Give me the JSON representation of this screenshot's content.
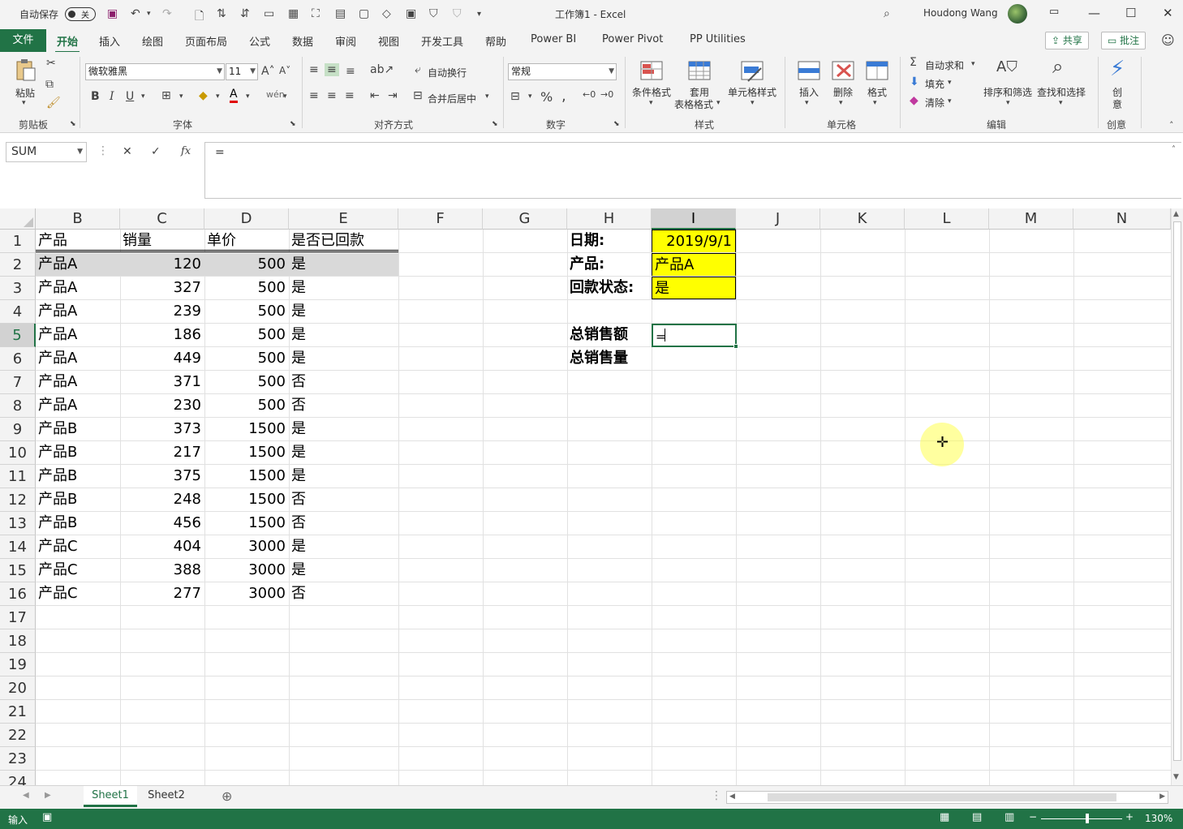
{
  "titlebar": {
    "autosave_label": "自动保存",
    "autosave_state": "关",
    "title": "工作簿1  -  Excel",
    "user": "Houdong Wang"
  },
  "tabs": {
    "file": "文件",
    "items": [
      "开始",
      "插入",
      "绘图",
      "页面布局",
      "公式",
      "数据",
      "审阅",
      "视图",
      "开发工具",
      "帮助",
      "Power BI",
      "Power Pivot",
      "PP Utilities"
    ],
    "share": "共享",
    "comments": "批注"
  },
  "ribbon": {
    "paste": "粘贴",
    "clipboard": "剪贴板",
    "font_name": "微软雅黑",
    "font_size": "11",
    "font_group": "字体",
    "wrap_text": "自动换行",
    "merge_center": "合并后居中",
    "align_group": "对齐方式",
    "number_format": "常规",
    "number_group": "数字",
    "cond_format": "条件格式",
    "table_format_1": "套用",
    "table_format_2": "表格格式",
    "cell_styles": "单元格样式",
    "styles_group": "样式",
    "insert": "插入",
    "delete": "删除",
    "format": "格式",
    "cells_group": "单元格",
    "autosum": "自动求和",
    "fill": "填充",
    "clear": "清除",
    "sort_filter": "排序和筛选",
    "find_select": "查找和选择",
    "edit_group": "编辑",
    "ideas_1": "创",
    "ideas_2": "意",
    "ideas_group": "创意"
  },
  "formula_bar": {
    "name_box": "SUM",
    "fx": "fx",
    "content": "="
  },
  "grid": {
    "columns": [
      "B",
      "C",
      "D",
      "E",
      "F",
      "G",
      "H",
      "I",
      "J",
      "K",
      "L",
      "M",
      "N"
    ],
    "selected_column": "I",
    "rows": [
      "1",
      "2",
      "3",
      "4",
      "5",
      "6",
      "7",
      "8",
      "9",
      "10",
      "11",
      "12",
      "13",
      "14",
      "15",
      "16",
      "17",
      "18",
      "19",
      "20",
      "21",
      "22",
      "23",
      "24"
    ],
    "selected_row": "5",
    "headers": [
      "产品",
      "销量",
      "单价",
      "是否已回款"
    ],
    "data": [
      [
        "产品A",
        "120",
        "500",
        "是"
      ],
      [
        "产品A",
        "327",
        "500",
        "是"
      ],
      [
        "产品A",
        "239",
        "500",
        "是"
      ],
      [
        "产品A",
        "186",
        "500",
        "是"
      ],
      [
        "产品A",
        "449",
        "500",
        "是"
      ],
      [
        "产品A",
        "371",
        "500",
        "否"
      ],
      [
        "产品A",
        "230",
        "500",
        "否"
      ],
      [
        "产品B",
        "373",
        "1500",
        "是"
      ],
      [
        "产品B",
        "217",
        "1500",
        "是"
      ],
      [
        "产品B",
        "375",
        "1500",
        "是"
      ],
      [
        "产品B",
        "248",
        "1500",
        "否"
      ],
      [
        "产品B",
        "456",
        "1500",
        "否"
      ],
      [
        "产品C",
        "404",
        "3000",
        "是"
      ],
      [
        "产品C",
        "388",
        "3000",
        "是"
      ],
      [
        "产品C",
        "277",
        "3000",
        "否"
      ]
    ],
    "criteria": {
      "date_label": "日期:",
      "date_value": "2019/9/1",
      "product_label": "产品:",
      "product_value": "产品A",
      "status_label": "回款状态:",
      "status_value": "是",
      "total_sales_label": "总销售额",
      "total_qty_label": "总销售量",
      "editing_value": "="
    },
    "fill_color": "#ffff00"
  },
  "sheets": {
    "items": [
      "Sheet1",
      "Sheet2"
    ],
    "active": "Sheet1"
  },
  "status": {
    "mode": "输入",
    "zoom": "130%"
  }
}
